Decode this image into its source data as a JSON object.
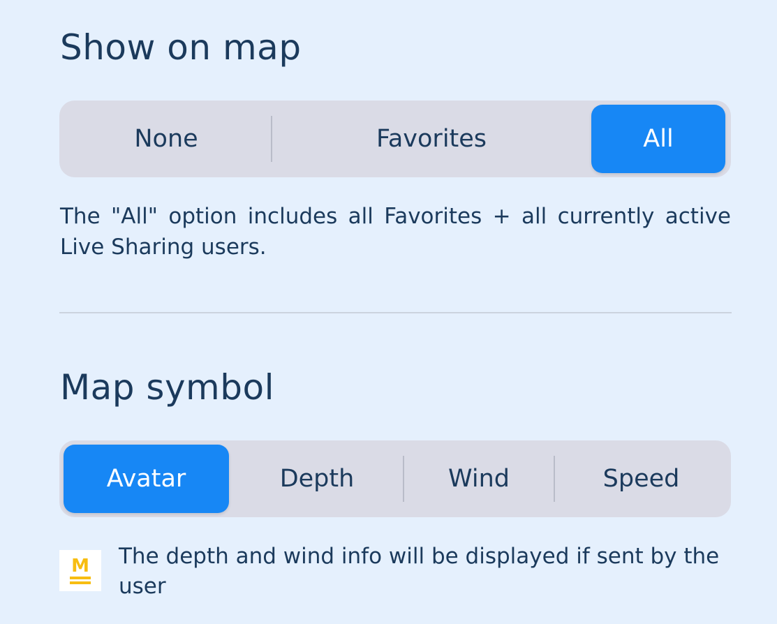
{
  "show_on_map": {
    "title": "Show on map",
    "options": [
      "None",
      "Favorites",
      "All"
    ],
    "selected": "All",
    "description": "The \"All\" option includes all Favorites + all currently active Live Sharing users."
  },
  "map_symbol": {
    "title": "Map symbol",
    "options": [
      "Avatar",
      "Depth",
      "Wind",
      "Speed"
    ],
    "selected": "Avatar",
    "hint_icon": "m-underline-icon",
    "hint": "The depth and wind info will be displayed if sent by the user"
  },
  "colors": {
    "background": "#e5f0fd",
    "accent": "#1787f5",
    "segment_bg": "#dadbe6",
    "text": "#1b3a5c",
    "icon": "#f7bd12"
  }
}
